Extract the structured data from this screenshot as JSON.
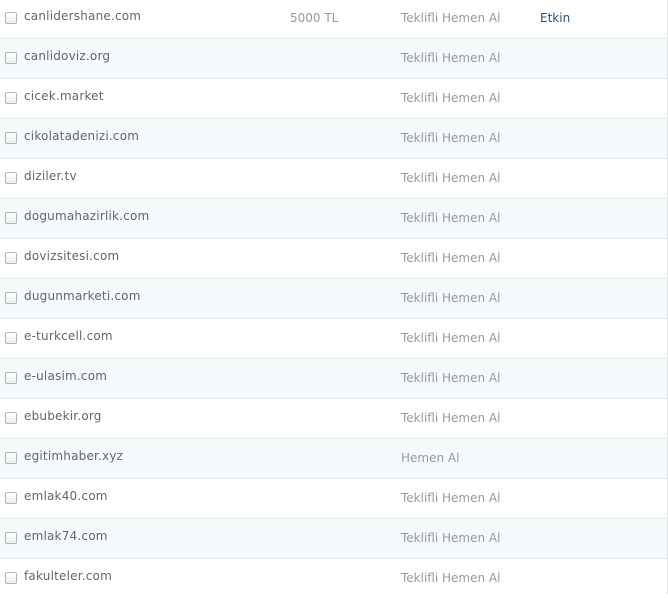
{
  "rows": [
    {
      "domain": "canlidershane.com",
      "price": "5000 TL",
      "sale_type": "Teklifli Hemen Al",
      "status": "Etkin"
    },
    {
      "domain": "canlidoviz.org",
      "price": "",
      "sale_type": "Teklifli Hemen Al",
      "status": ""
    },
    {
      "domain": "cicek.market",
      "price": "",
      "sale_type": "Teklifli Hemen Al",
      "status": ""
    },
    {
      "domain": "cikolatadenizi.com",
      "price": "",
      "sale_type": "Teklifli Hemen Al",
      "status": ""
    },
    {
      "domain": "diziler.tv",
      "price": "",
      "sale_type": "Teklifli Hemen Al",
      "status": ""
    },
    {
      "domain": "dogumahazirlik.com",
      "price": "",
      "sale_type": "Teklifli Hemen Al",
      "status": ""
    },
    {
      "domain": "dovizsitesi.com",
      "price": "",
      "sale_type": "Teklifli Hemen Al",
      "status": ""
    },
    {
      "domain": "dugunmarketi.com",
      "price": "",
      "sale_type": "Teklifli Hemen Al",
      "status": ""
    },
    {
      "domain": "e-turkcell.com",
      "price": "",
      "sale_type": "Teklifli Hemen Al",
      "status": ""
    },
    {
      "domain": "e-ulasim.com",
      "price": "",
      "sale_type": "Teklifli Hemen Al",
      "status": ""
    },
    {
      "domain": "ebubekir.org",
      "price": "",
      "sale_type": "Teklifli Hemen Al",
      "status": ""
    },
    {
      "domain": "egitimhaber.xyz",
      "price": "",
      "sale_type": "Hemen Al",
      "status": ""
    },
    {
      "domain": "emlak40.com",
      "price": "",
      "sale_type": "Teklifli Hemen Al",
      "status": ""
    },
    {
      "domain": "emlak74.com",
      "price": "",
      "sale_type": "Teklifli Hemen Al",
      "status": ""
    },
    {
      "domain": "fakulteler.com",
      "price": "",
      "sale_type": "Teklifli Hemen Al",
      "status": ""
    }
  ]
}
